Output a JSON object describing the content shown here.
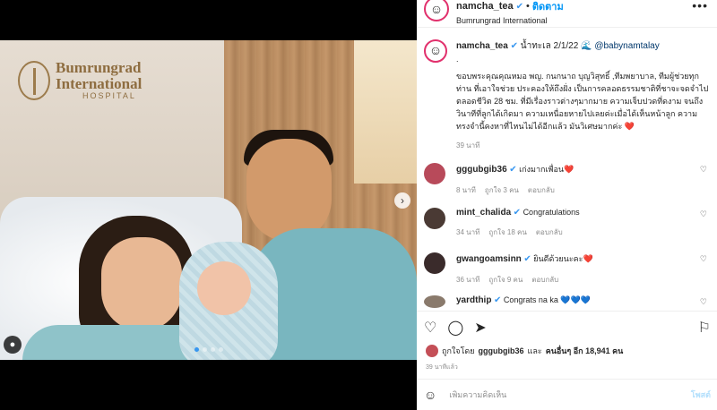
{
  "header": {
    "username": "namcha_tea",
    "follow_label": "ติดตาม",
    "location": "Bumrungrad International",
    "more_icon": "more-horizontal-icon"
  },
  "photo": {
    "hospital_line1": "Bumrungrad",
    "hospital_line2": "International",
    "hospital_line3": "HOSPITAL",
    "next_icon": "›",
    "carousel_count": 4,
    "carousel_active": 1
  },
  "caption": {
    "username": "namcha_tea",
    "prefix": "น้ำทะเล 2/1/22 ",
    "wave": "🌊",
    "mention": "@babynamtalay",
    "dot": ".",
    "text": "ขอบพระคุณคุณหมอ พญ. กนกนาถ บุญวิสุทธิ์ ,ทีมพยาบาล, ทีมผู้ช่วยทุกท่าน ที่เอาใจช่วย ประคองให้ถึงฝั่ง เป็นการคลอดธรรมชาติที่ชาจะจดจำไปตลอดชีวิต 28 ชม. ที่มีเรื่องราวต่างๆมากมาย ความเจ็บปวดที่ดงาม จนถึงวินาทีที่ลูกได้เกิดมา ความเหนื่อยหายไปเลยค่ะเมื่อได้เห็นหน้าลูก ความทรงจำนี้คงหาที่ไหนไม่ได้อีกแล้ว มันวิเศษมากค่ะ",
    "heart": "❤️",
    "time": "39 นาที"
  },
  "comments": [
    {
      "user": "gggubgib36",
      "text": "เก่งมากเพื่อน❤️",
      "time": "8 นาที",
      "likes": "ถูกใจ 3 คน",
      "reply": "ตอบกลับ",
      "avatar_color": "#b84a5a"
    },
    {
      "user": "mint_chalida",
      "text": "Congratulations",
      "time": "34 นาที",
      "likes": "ถูกใจ 18 คน",
      "reply": "ตอบกลับ",
      "avatar_color": "#4a3a34"
    },
    {
      "user": "gwangoamsinn",
      "text": "ยินดีด้วยนะคะ❤️",
      "time": "36 นาที",
      "likes": "ถูกใจ 9 คน",
      "reply": "ตอบกลับ",
      "avatar_color": "#3a2b2b"
    },
    {
      "user": "yardthip",
      "text": "Congrats na ka 💙💙💙",
      "avatar_color": "#8a7a6c"
    }
  ],
  "actions": {
    "like_icon": "heart-outline-icon",
    "comment_icon": "comment-icon",
    "share_icon": "send-icon",
    "save_icon": "bookmark-icon"
  },
  "likes": {
    "prefix": "ถูกใจโดย ",
    "user": "gggubgib36",
    "middle": " และ ",
    "others": "คนอื่นๆ อีก 18,941 คน"
  },
  "post_time": "39 นาทีแล้ว",
  "add_comment": {
    "emoji": "☺",
    "placeholder": "เพิ่มความคิดเห็น",
    "post_label": "โพสต์"
  },
  "colors": {
    "accent": "#0095f6",
    "verified": "#3897f0",
    "story_ring": "#e1306c"
  }
}
